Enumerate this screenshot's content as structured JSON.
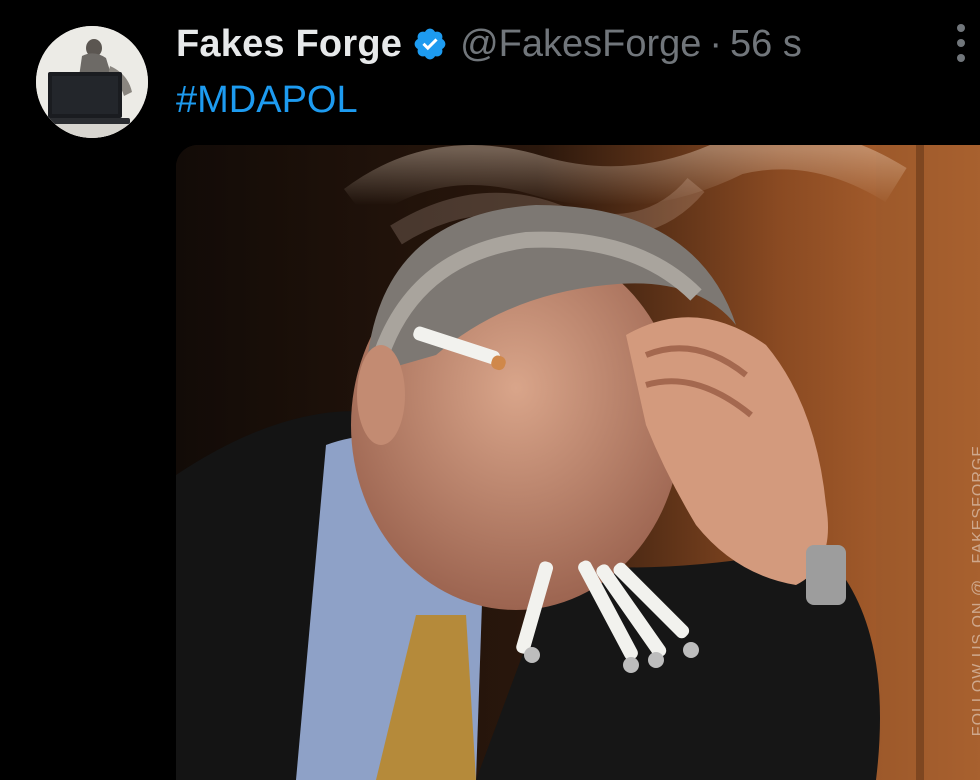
{
  "post": {
    "author": {
      "display_name": "Fakes Forge",
      "handle": "@FakesForge",
      "verified": true
    },
    "separator": "·",
    "timestamp": "56 s",
    "text": "#MDAPOL",
    "media": {
      "type": "photo",
      "watermark": "FOLLOW US ON @ _FAKESFORGE"
    }
  },
  "colors": {
    "background": "#000000",
    "name": "#e7e9ea",
    "muted": "#71767b",
    "link": "#1d9bf0",
    "verified_badge": "#1d9bf0"
  },
  "icons": {
    "verified": "verified-badge-icon",
    "more": "more-options-icon"
  }
}
